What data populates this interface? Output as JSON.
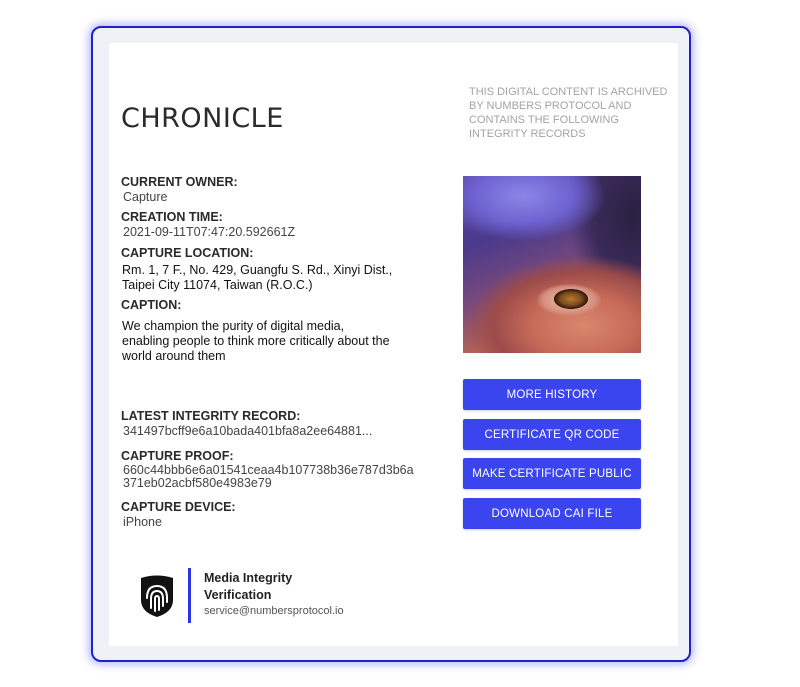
{
  "title": "CHRONICLE",
  "archive_note": "THIS DIGITAL CONTENT IS ARCHIVED BY NUMBERS PROTOCOL AND CONTAINS THE FOLLOWING INTEGRITY RECORDS",
  "fields": {
    "current_owner": {
      "label": "CURRENT OWNER:",
      "value": "Capture"
    },
    "creation_time": {
      "label": "CREATION TIME:",
      "value": "2021-09-11T07:47:20.592661Z"
    },
    "capture_location": {
      "label": "CAPTURE LOCATION:",
      "value_line1": "Rm. 1, 7 F., No. 429, Guangfu S. Rd., Xinyi Dist.,",
      "value_line2": "Taipei City 11074, Taiwan (R.O.C.)"
    },
    "caption": {
      "label": "CAPTION:",
      "value_line1": "We champion the purity of digital media,",
      "value_line2": "enabling people to think more critically about the",
      "value_line3": "world around them"
    },
    "latest_integrity_record": {
      "label": "LATEST INTEGRITY RECORD:",
      "value": "341497bcff9e6a10bada401bfa8a2ee64881..."
    },
    "capture_proof": {
      "label": "CAPTURE PROOF:",
      "value_line1": "660c44bbb6e6a01541ceaa4b107738b36e787d3b6a",
      "value_line2": "371eb02acbf580e4983e79"
    },
    "capture_device": {
      "label": "CAPTURE DEVICE:",
      "value": "iPhone"
    }
  },
  "buttons": {
    "more_history": "MORE HISTORY",
    "certificate_qr": "CERTIFICATE QR CODE",
    "make_public": "MAKE CERTIFICATE PUBLIC",
    "download_cai": "DOWNLOAD CAI FILE"
  },
  "footer": {
    "brand_line1": "Media Integrity",
    "brand_line2": "Verification",
    "email": "service@numbersprotocol.io",
    "logo_icon": "fingerprint-shield-icon"
  },
  "colors": {
    "accent": "#3a45f0",
    "frame_border": "#1e22c8",
    "divider": "#2b36e0"
  }
}
